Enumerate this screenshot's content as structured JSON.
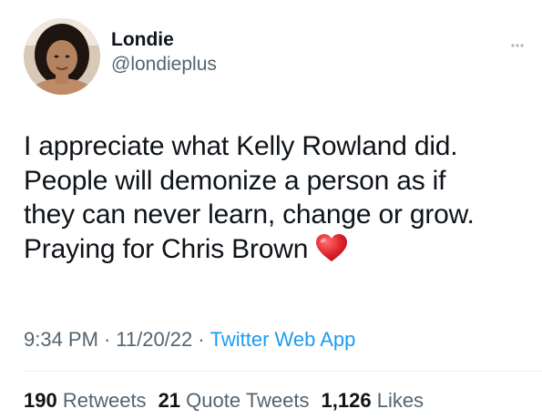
{
  "user": {
    "display_name": "Londie",
    "handle": "@londieplus"
  },
  "tweet": {
    "lines": [
      "I appreciate what Kelly Rowland did.",
      "People will demonize a person as if",
      "they can never learn, change or grow.",
      "Praying for Chris Brown"
    ],
    "emoji": "red-heart"
  },
  "meta": {
    "time": "9:34 PM",
    "date": "11/20/22",
    "separator": "·",
    "source": "Twitter Web App"
  },
  "stats": {
    "retweets_count": "190",
    "retweets_label": "Retweets",
    "quotes_count": "21",
    "quotes_label": "Quote Tweets",
    "likes_count": "1,126",
    "likes_label": "Likes"
  },
  "colors": {
    "text": "#0f1419",
    "secondary": "#536471",
    "link": "#1d9bf0",
    "heart": "#e0242c"
  }
}
